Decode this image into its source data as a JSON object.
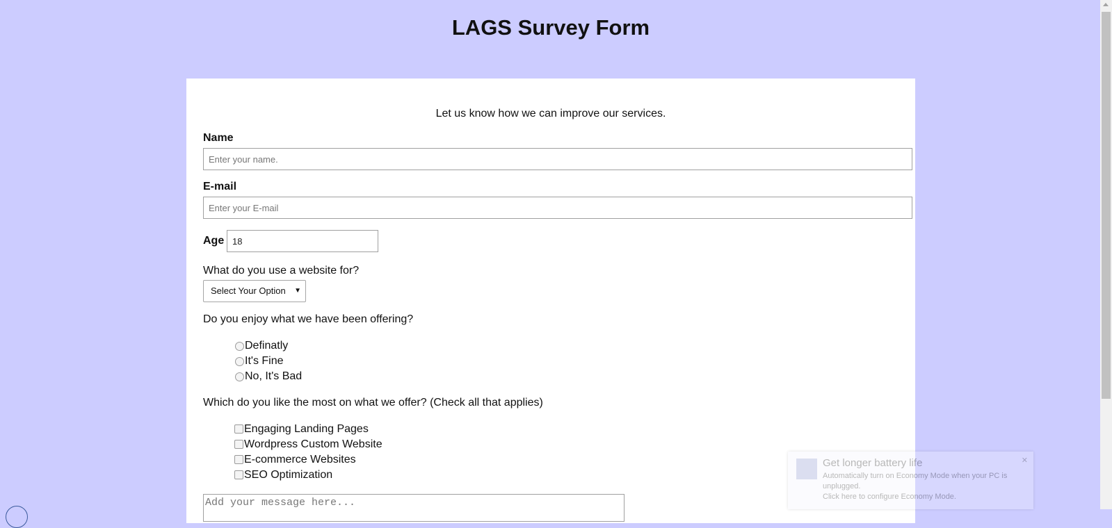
{
  "header": {
    "title": "LAGS Survey Form"
  },
  "form": {
    "subtitle": "Let us know how we can improve our services.",
    "name": {
      "label": "Name",
      "placeholder": "Enter your name."
    },
    "email": {
      "label": "E-mail",
      "placeholder": "Enter your E-mail"
    },
    "age": {
      "label": "Age",
      "value": "18"
    },
    "usage": {
      "question": "What do you use a website for?",
      "selected": "Select Your Option"
    },
    "enjoy": {
      "question": "Do you enjoy what we have been offering?",
      "options": [
        "Definatly",
        "It's Fine",
        "No, It's Bad"
      ]
    },
    "likes": {
      "question": "Which do you like the most on what we offer? (Check all that applies)",
      "options": [
        "Engaging Landing Pages",
        "Wordpress Custom Website",
        "E-commerce Websites",
        "SEO Optimization"
      ]
    },
    "message": {
      "placeholder": "Add your message here..."
    }
  },
  "notification": {
    "title": "Get longer battery life",
    "body": "Automatically turn on Economy Mode when your PC is unplugged.",
    "action": "Click here to configure Economy Mode.",
    "close_glyph": "✕"
  }
}
